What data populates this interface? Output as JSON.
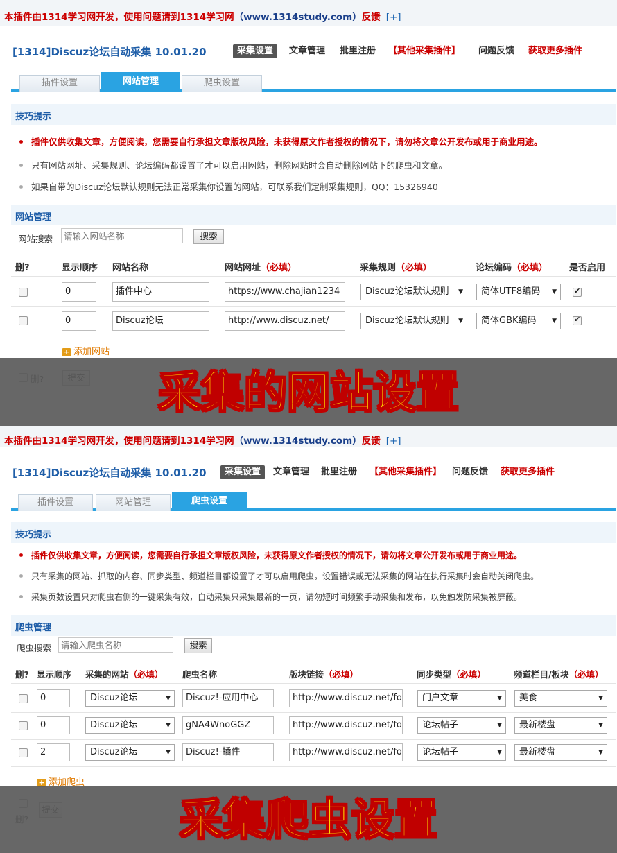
{
  "panel_a": {
    "notice": {
      "text": "本插件由1314学习网开发，使用问题请到1314学习网",
      "site": "（www.1314study.com）",
      "feedback": "反馈",
      "link": "[+]"
    },
    "app_title": "[1314]Discuz论坛自动采集 10.01.20",
    "nav": [
      "采集设置",
      "文章管理",
      "批里注册",
      "【其他采集插件】",
      "问题反馈",
      "获取更多插件"
    ],
    "tabs": [
      "插件设置",
      "网站管理",
      "爬虫设置"
    ],
    "tips_title": "技巧提示",
    "tips": [
      "插件仅供收集文章，方便阅读，您需要自行承担文章版权风险，未获得原文作者授权的情况下，请勿将文章公开发布或用于商业用途。",
      "只有网站网址、采集规则、论坛编码都设置了才可以启用网站，删除网站时会自动删除网站下的爬虫和文章。",
      "如果自带的Discuz论坛默认规则无法正常采集你设置的网站，可联系我们定制采集规则，QQ：15326940"
    ],
    "section_title": "网站管理",
    "search": {
      "label": "网站搜索",
      "placeholder": "请输入网站名称",
      "button": "搜索"
    },
    "columns": {
      "delete": "删?",
      "order": "显示顺序",
      "name": "网站名称",
      "url": "网站网址",
      "url_req": "（必填）",
      "rule": "采集规则",
      "rule_req": "（必填）",
      "encoding": "论坛编码",
      "encoding_req": "（必填）",
      "enabled": "是否启用"
    },
    "rows": [
      {
        "order": "0",
        "name": "插件中心",
        "url": "https://www.chajian1234",
        "rule": "Discuz论坛默认规则",
        "encoding": "简体UTF8编码",
        "enabled": true
      },
      {
        "order": "0",
        "name": "Discuz论坛",
        "url": "http://www.discuz.net/",
        "rule": "Discuz论坛默认规则",
        "encoding": "简体GBK编码",
        "enabled": true
      }
    ],
    "add_label": "添加网站",
    "footer_delete": "删?",
    "submit": "提交",
    "banner": "采集的网站设置"
  },
  "panel_b": {
    "notice": {
      "text": "本插件由1314学习网开发，使用问题请到1314学习网",
      "site": "（www.1314study.com）",
      "feedback": "反馈",
      "link": "[+]"
    },
    "app_title": "[1314]Discuz论坛自动采集 10.01.20",
    "nav": [
      "采集设置",
      "文章管理",
      "批里注册",
      "【其他采集插件】",
      "问题反馈",
      "获取更多插件"
    ],
    "tabs": [
      "插件设置",
      "网站管理",
      "爬虫设置"
    ],
    "tips_title": "技巧提示",
    "tips": [
      "插件仅供收集文章，方便阅读，您需要自行承担文章版权风险，未获得原文作者授权的情况下，请勿将文章公开发布或用于商业用途。",
      "只有采集的网站、抓取的内容、同步类型、频道栏目都设置了才可以启用爬虫，设置错误或无法采集的网站在执行采集时会自动关闭爬虫。",
      "采集页数设置只对爬虫右侧的一键采集有效，自动采集只采集最新的一页，请勿短时间频繁手动采集和发布，以免触发防采集被屏蔽。"
    ],
    "section_title": "爬虫管理",
    "search": {
      "label": "爬虫搜索",
      "placeholder": "请输入爬虫名称",
      "button": "搜索"
    },
    "columns": {
      "delete": "删?",
      "order": "显示顺序",
      "site": "采集的网站",
      "site_req": "（必填）",
      "name": "爬虫名称",
      "link": "版块链接",
      "link_req": "（必填）",
      "sync": "同步类型",
      "sync_req": "（必填）",
      "channel": "频道栏目/板块",
      "channel_req": "（必填）"
    },
    "rows": [
      {
        "order": "0",
        "site": "Discuz论坛",
        "name": "Discuz!-应用中心",
        "link": "http://www.discuz.net/fo",
        "sync": "门户文章",
        "channel": "美食"
      },
      {
        "order": "0",
        "site": "Discuz论坛",
        "name": "gNA4WnoGGZ",
        "link": "http://www.discuz.net/fo",
        "sync": "论坛帖子",
        "channel": "最新楼盘"
      },
      {
        "order": "2",
        "site": "Discuz论坛",
        "name": "Discuz!-插件",
        "link": "http://www.discuz.net/fo",
        "sync": "论坛帖子",
        "channel": "最新楼盘"
      }
    ],
    "add_label": "添加爬虫",
    "footer_delete": "删?",
    "submit": "提交",
    "banner": "采集爬虫设置"
  }
}
